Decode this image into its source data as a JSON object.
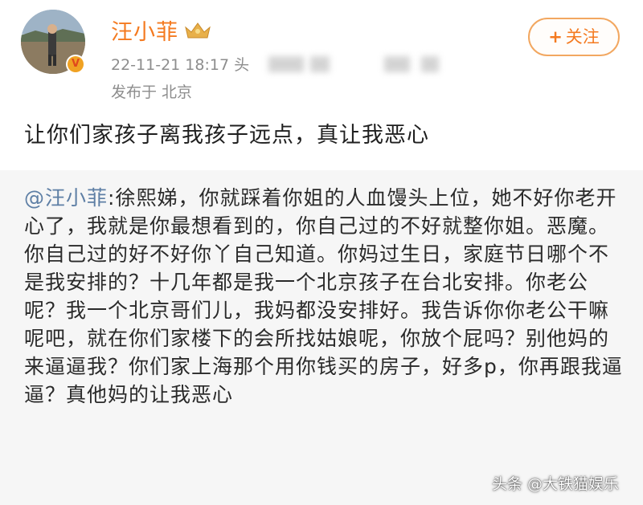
{
  "post": {
    "username": "汪小菲",
    "timestamp": "22-11-21 18:17",
    "source_prefix": "头",
    "location": "发布于 北京",
    "follow_label": "关注",
    "follow_icon": "+",
    "text": "让你们家孩子离我孩子远点，真让我恶心"
  },
  "repost": {
    "mention": "@汪小菲",
    "body": ":徐熙娣，你就踩着你姐的人血馒头上位，她不好你老开心了，我就是你最想看到的，你自己过的不好就整你姐。恶魔。你自己过的好不好你丫自己知道。你妈过生日，家庭节日哪个不是我安排的？十几年都是我一个北京孩子在台北安排。你老公呢？我一个北京哥们儿，我妈都没安排好。我告诉你你老公干嘛呢吧，就在你们家楼下的会所找姑娘呢，你放个屁吗？别他妈的来逼逼我？你们家上海那个用你钱买的房子，好多p，你再跟我逼逼？真他妈的让我恶心"
  },
  "watermark": "头条 @大铁猫娱乐",
  "icons": {
    "verified": "verified-badge-icon",
    "crown": "crown-icon"
  },
  "colors": {
    "accent": "#f47a20",
    "mention": "#5e7fa5",
    "meta": "#8d8d8d"
  }
}
